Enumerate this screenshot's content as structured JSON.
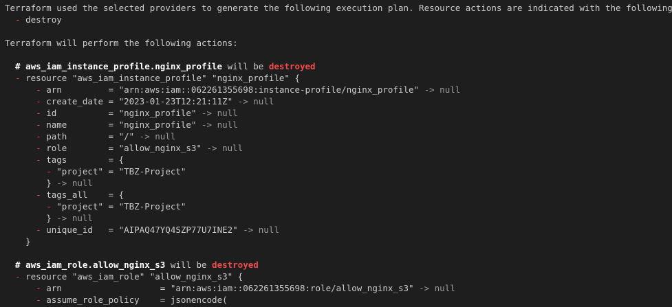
{
  "terminal": {
    "intro": [
      "Terraform used the selected providers to generate the following execution plan. Resource actions are indicated with the following symbols:",
      "  - destroy",
      "",
      "Terraform will perform the following actions:",
      ""
    ],
    "resources": [
      {
        "comment_prefix": "  # ",
        "address": "aws_iam_instance_profile.nginx_profile",
        "will_be": " will be ",
        "action": "destroyed",
        "resource_line": "resource \"aws_iam_instance_profile\" \"nginx_profile\" {",
        "attributes": [
          {
            "text": "arn         = \"arn:aws:iam::062261355698:instance-profile/nginx_profile\"",
            "suffix": " -> null"
          },
          {
            "text": "create_date = \"2023-01-23T12:21:11Z\"",
            "suffix": " -> null"
          },
          {
            "text": "id          = \"nginx_profile\"",
            "suffix": " -> null"
          },
          {
            "text": "name        = \"nginx_profile\"",
            "suffix": " -> null"
          },
          {
            "text": "path        = \"/\"",
            "suffix": " -> null"
          },
          {
            "text": "role        = \"allow_nginx_s3\"",
            "suffix": " -> null"
          },
          {
            "text": "tags        = {",
            "suffix": ""
          },
          {
            "text": "    \"project\" = \"TBZ-Project\"",
            "suffix": "",
            "nested": true
          },
          {
            "text": "  }",
            "suffix": " -> null",
            "closing": true
          },
          {
            "text": "tags_all    = {",
            "suffix": ""
          },
          {
            "text": "    \"project\" = \"TBZ-Project\"",
            "suffix": "",
            "nested": true
          },
          {
            "text": "  }",
            "suffix": " -> null",
            "closing": true
          },
          {
            "text": "unique_id   = \"AIPAQ47YQ4SZP77U7INE2\"",
            "suffix": " -> null"
          }
        ],
        "close_brace": "    }"
      },
      {
        "comment_prefix": "  # ",
        "address": "aws_iam_role.allow_nginx_s3",
        "will_be": " will be ",
        "action": "destroyed",
        "resource_line": "resource \"aws_iam_role\" \"allow_nginx_s3\" {",
        "attributes": [
          {
            "text": "arn                   = \"arn:aws:iam::062261355698:role/allow_nginx_s3\"",
            "suffix": " -> null"
          },
          {
            "text": "assume_role_policy    = jsonencode(",
            "suffix": ""
          }
        ]
      }
    ],
    "minus_sign": "-",
    "colors": {
      "background": "#1e1e1e",
      "text": "#cccccc",
      "minus": "#f14c4c",
      "null_suffix": "#9a9a9a",
      "address": "#ffffff"
    }
  }
}
